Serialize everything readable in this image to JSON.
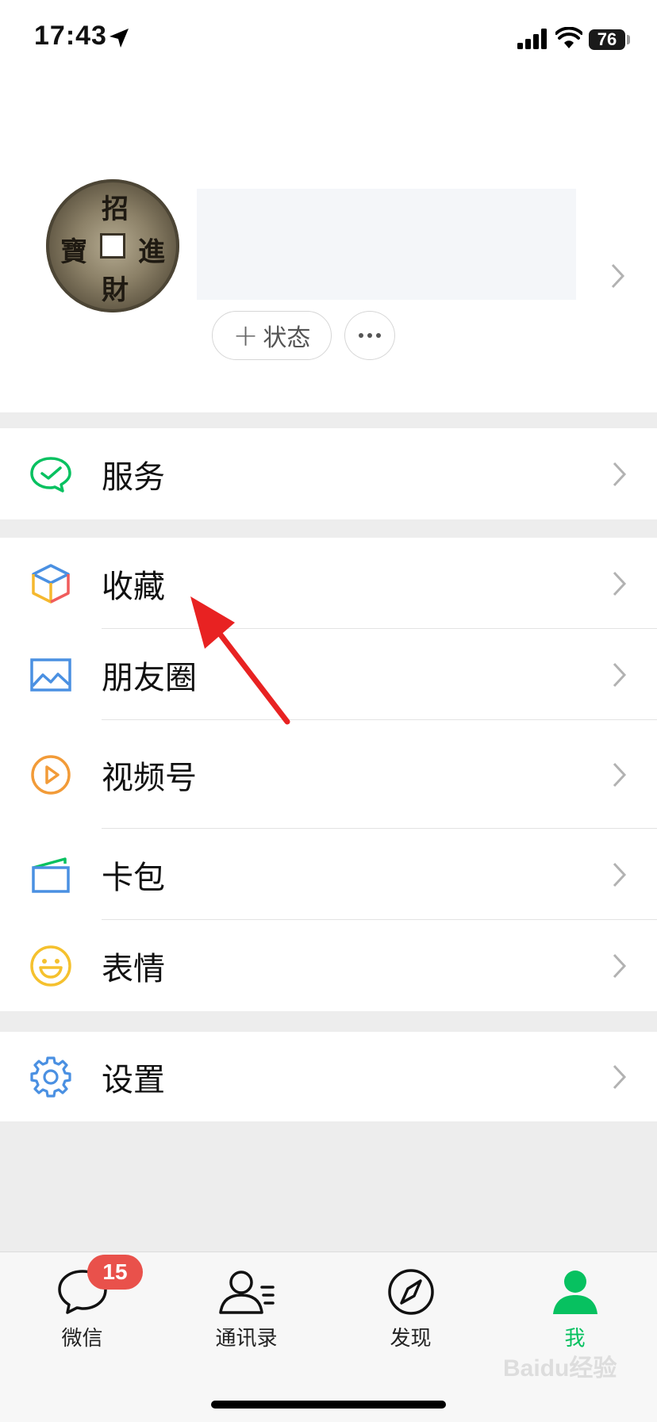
{
  "status_bar": {
    "time": "17:43",
    "battery": "76"
  },
  "profile": {
    "status_button_label": "状态",
    "coin_chars": [
      "招",
      "進",
      "財",
      "寶"
    ]
  },
  "menu": {
    "services": {
      "label": "服务",
      "icon": "wechat-pay-icon"
    },
    "favorites": {
      "label": "收藏",
      "icon": "cube-icon"
    },
    "moments": {
      "label": "朋友圈",
      "icon": "picture-icon"
    },
    "channels": {
      "label": "视频号",
      "icon": "play-circle-icon"
    },
    "cards": {
      "label": "卡包",
      "icon": "wallet-icon"
    },
    "stickers": {
      "label": "表情",
      "icon": "smiley-icon"
    },
    "settings": {
      "label": "设置",
      "icon": "gear-icon"
    }
  },
  "tabbar": {
    "chats": {
      "label": "微信",
      "badge": "15"
    },
    "contacts": {
      "label": "通讯录"
    },
    "discover": {
      "label": "发现"
    },
    "me": {
      "label": "我",
      "active": true
    }
  },
  "colors": {
    "accent": "#07c160",
    "badge": "#e9514b",
    "annotation_arrow": "#e82222"
  },
  "watermark": "Baidu经验"
}
